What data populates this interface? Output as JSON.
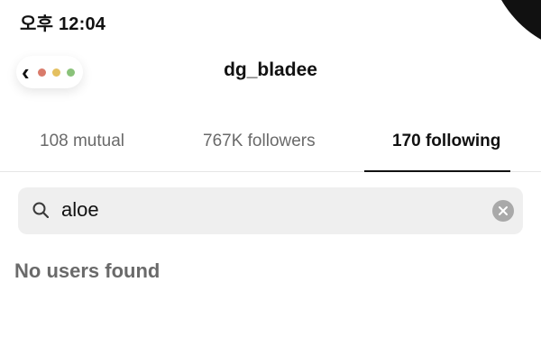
{
  "status_bar": {
    "time": "오후 12:04"
  },
  "nav": {
    "back_icon": "chevron-left-icon",
    "title": "dg_bladee",
    "dot_colors": [
      "#d97b6b",
      "#e4c060",
      "#8ac27a"
    ]
  },
  "tabs": {
    "items": [
      {
        "label": "108 mutual",
        "selected": false
      },
      {
        "label": "767K followers",
        "selected": false
      },
      {
        "label": "170 following",
        "selected": true
      }
    ]
  },
  "search": {
    "value": "aloe",
    "icon": "search-icon",
    "clear_icon": "clear-icon"
  },
  "results": {
    "empty_message": "No users found"
  },
  "colors": {
    "selected_tab": "#111111",
    "unselected_tab": "#6a6a6a",
    "search_bg": "#efefef"
  }
}
